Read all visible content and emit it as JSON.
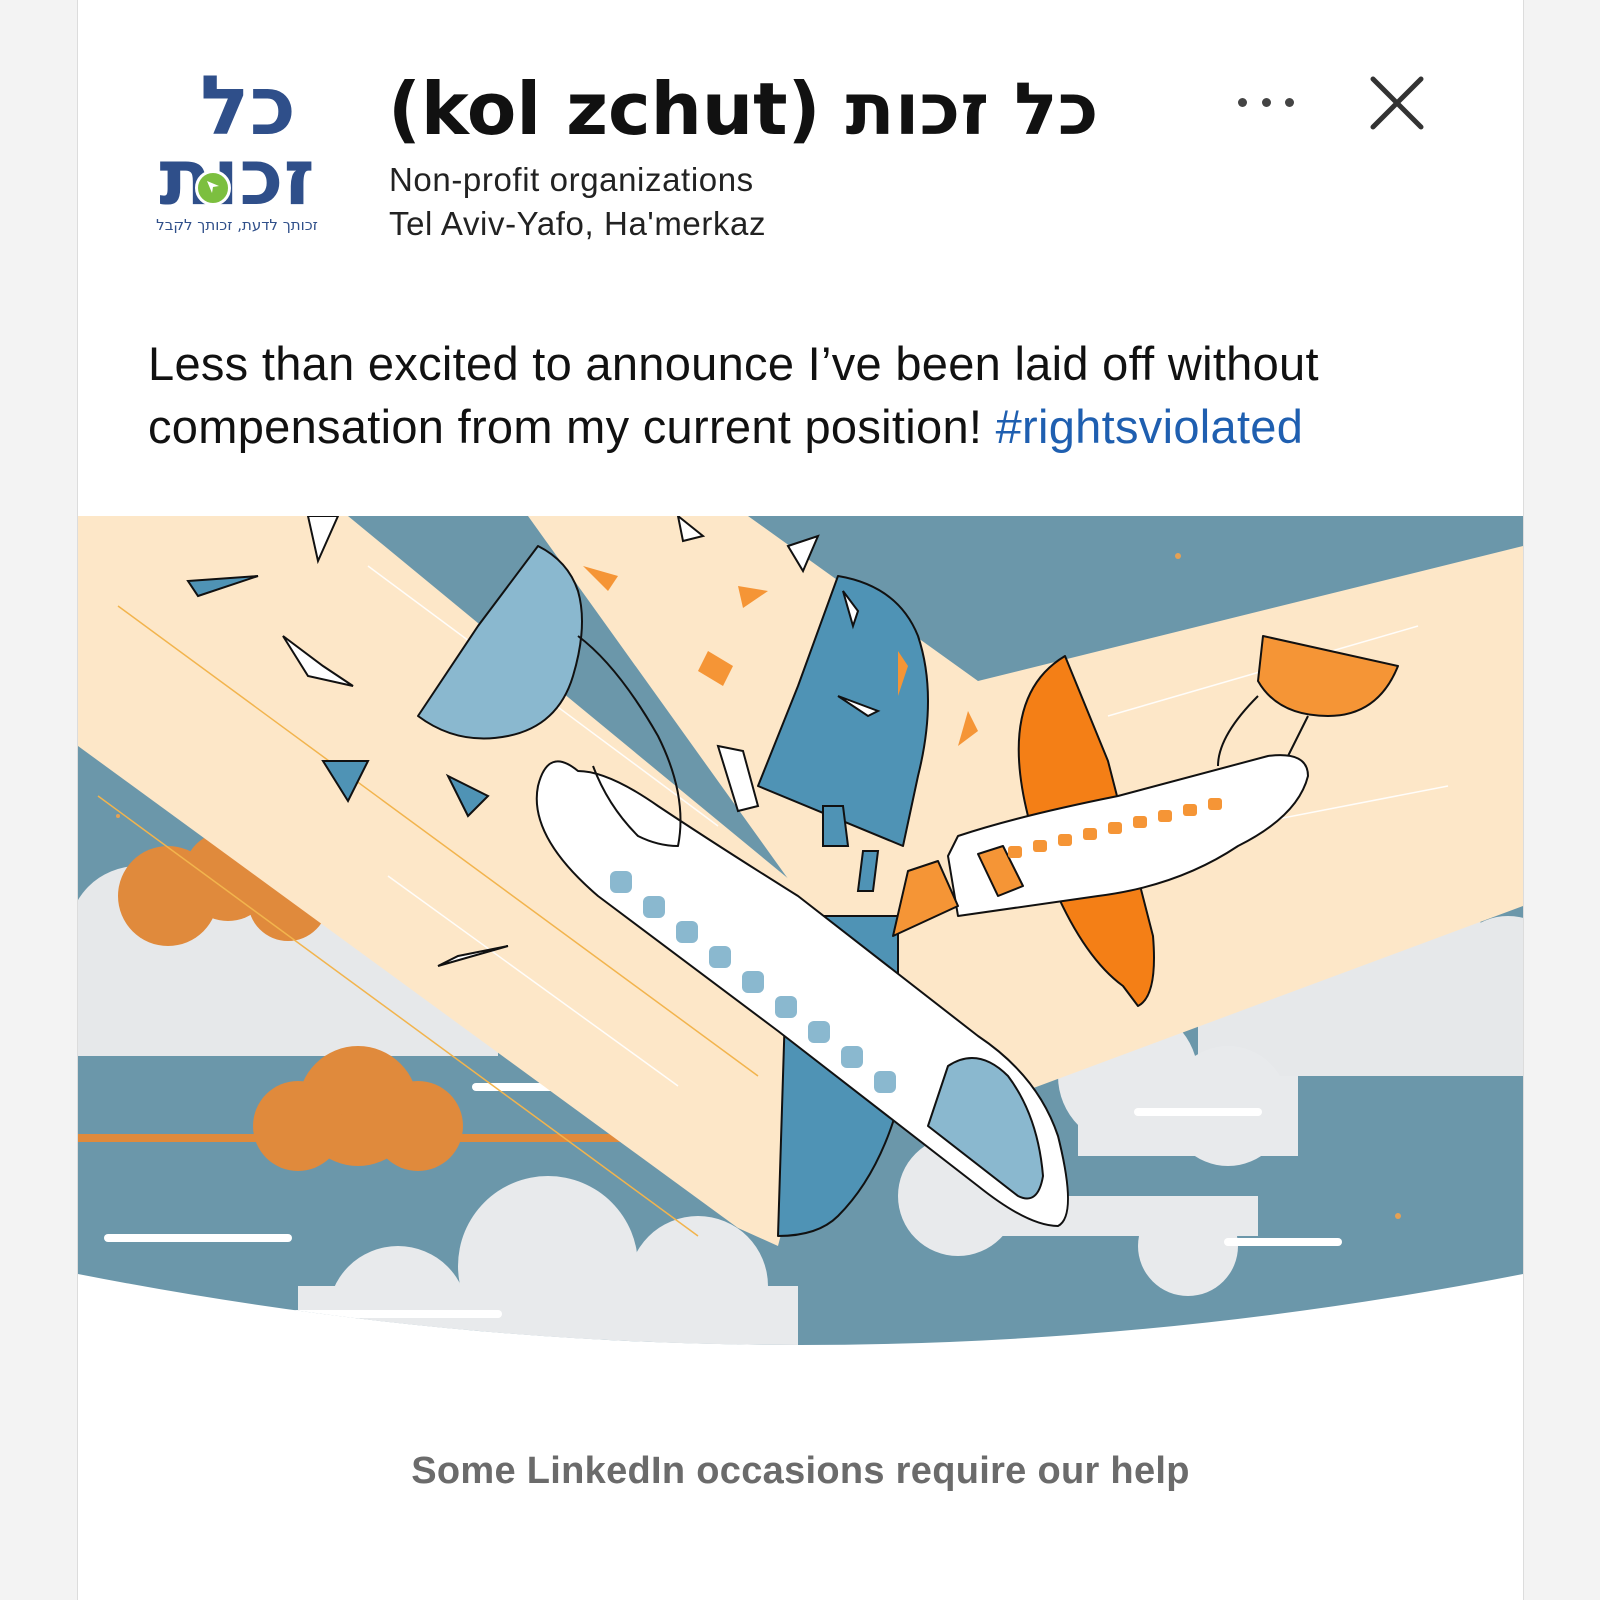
{
  "organization": {
    "logo_top_text": "כל",
    "logo_bottom_text": "זכות",
    "logo_tagline": "זכותך לדעת, זכותך לקבל",
    "name": "(kol zchut) כל זכות",
    "category": "Non-profit organizations",
    "location": "Tel Aviv-Yafo, Ha'merkaz"
  },
  "actions": {
    "more_icon": "more-horizontal-icon",
    "close_icon": "close-icon"
  },
  "post": {
    "text": "Less than excited to announce I’ve been laid off without compensation from my current position! ",
    "hashtag": "#rightsviolated"
  },
  "caption": "Some LinkedIn occasions require our help",
  "colors": {
    "brand_blue": "#2f4f8a",
    "brand_green": "#7cbf3f",
    "hashtag_blue": "#1f5fb0",
    "sky_blue": "#6b97aa",
    "accent_orange": "#f5801f",
    "plane_blue": "#4f93b5",
    "light_blue": "#8ab8cf",
    "beam_cream": "#fde7c8"
  }
}
